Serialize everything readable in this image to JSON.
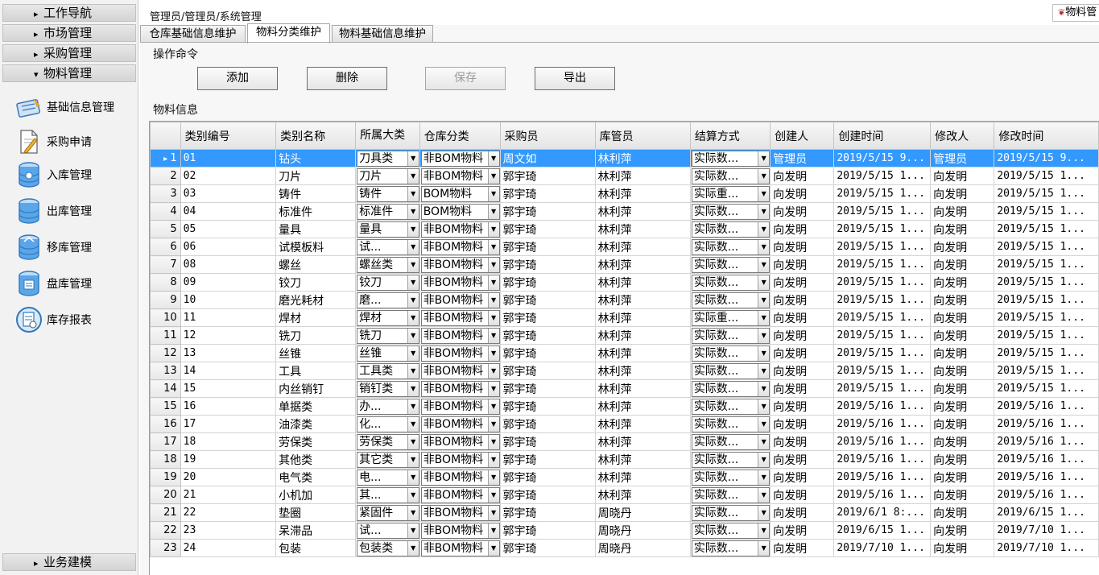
{
  "breadcrumb": "管理员/管理员/系统管理",
  "top_tab": "物料管",
  "sidebar": {
    "headers": [
      {
        "label": "工作导航",
        "arrow": "▸"
      },
      {
        "label": "市场管理",
        "arrow": "▸"
      },
      {
        "label": "采购管理",
        "arrow": "▸"
      },
      {
        "label": "物料管理",
        "arrow": "▾"
      }
    ],
    "items": [
      {
        "label": "基础信息管理",
        "icon": "basic-info-icon"
      },
      {
        "label": "采购申请",
        "icon": "purchase-request-icon"
      },
      {
        "label": "入库管理",
        "icon": "inbound-database-icon"
      },
      {
        "label": "出库管理",
        "icon": "outbound-database-icon"
      },
      {
        "label": "移库管理",
        "icon": "transfer-database-icon"
      },
      {
        "label": "盘库管理",
        "icon": "inventory-check-icon"
      },
      {
        "label": "库存报表",
        "icon": "stock-report-icon"
      }
    ],
    "footer": {
      "label": "业务建模",
      "arrow": "▸"
    }
  },
  "tabs": [
    {
      "label": "仓库基础信息维护",
      "active": false
    },
    {
      "label": "物料分类维护",
      "active": true
    },
    {
      "label": "物料基础信息维护",
      "active": false
    }
  ],
  "ops": {
    "title": "操作命令",
    "add": "添加",
    "delete": "删除",
    "save": "保存",
    "export": "导出"
  },
  "info_title": "物料信息",
  "grid": {
    "columns": [
      "类别编号",
      "类别名称",
      "所属大类",
      "仓库分类",
      "采购员",
      "库管员",
      "结算方式",
      "创建人",
      "创建时间",
      "修改人",
      "修改时间"
    ],
    "rows": [
      [
        "1",
        "01",
        "钻头",
        "刀具类",
        "非BOM物料",
        "周文如",
        "林利萍",
        "实际数...",
        "管理员",
        "2019/5/15 9...",
        "管理员",
        "2019/5/15 9..."
      ],
      [
        "2",
        "02",
        "刀片",
        "刀片",
        "非BOM物料",
        "郭宇琦",
        "林利萍",
        "实际数...",
        "向发明",
        "2019/5/15 1...",
        "向发明",
        "2019/5/15 1..."
      ],
      [
        "3",
        "03",
        "铸件",
        "铸件",
        "BOM物料",
        "郭宇琦",
        "林利萍",
        "实际重...",
        "向发明",
        "2019/5/15 1...",
        "向发明",
        "2019/5/15 1..."
      ],
      [
        "4",
        "04",
        "标准件",
        "标准件",
        "BOM物料",
        "郭宇琦",
        "林利萍",
        "实际数...",
        "向发明",
        "2019/5/15 1...",
        "向发明",
        "2019/5/15 1..."
      ],
      [
        "5",
        "05",
        "量具",
        "量具",
        "非BOM物料",
        "郭宇琦",
        "林利萍",
        "实际数...",
        "向发明",
        "2019/5/15 1...",
        "向发明",
        "2019/5/15 1..."
      ],
      [
        "6",
        "06",
        "试模板料",
        "试...",
        "非BOM物料",
        "郭宇琦",
        "林利萍",
        "实际数...",
        "向发明",
        "2019/5/15 1...",
        "向发明",
        "2019/5/15 1..."
      ],
      [
        "7",
        "08",
        "螺丝",
        "螺丝类",
        "非BOM物料",
        "郭宇琦",
        "林利萍",
        "实际数...",
        "向发明",
        "2019/5/15 1...",
        "向发明",
        "2019/5/15 1..."
      ],
      [
        "8",
        "09",
        "铰刀",
        "铰刀",
        "非BOM物料",
        "郭宇琦",
        "林利萍",
        "实际数...",
        "向发明",
        "2019/5/15 1...",
        "向发明",
        "2019/5/15 1..."
      ],
      [
        "9",
        "10",
        "磨光耗材",
        "磨...",
        "非BOM物料",
        "郭宇琦",
        "林利萍",
        "实际数...",
        "向发明",
        "2019/5/15 1...",
        "向发明",
        "2019/5/15 1..."
      ],
      [
        "10",
        "11",
        "焊材",
        "焊材",
        "非BOM物料",
        "郭宇琦",
        "林利萍",
        "实际重...",
        "向发明",
        "2019/5/15 1...",
        "向发明",
        "2019/5/15 1..."
      ],
      [
        "11",
        "12",
        "铣刀",
        "铣刀",
        "非BOM物料",
        "郭宇琦",
        "林利萍",
        "实际数...",
        "向发明",
        "2019/5/15 1...",
        "向发明",
        "2019/5/15 1..."
      ],
      [
        "12",
        "13",
        "丝锥",
        "丝锥",
        "非BOM物料",
        "郭宇琦",
        "林利萍",
        "实际数...",
        "向发明",
        "2019/5/15 1...",
        "向发明",
        "2019/5/15 1..."
      ],
      [
        "13",
        "14",
        "工具",
        "工具类",
        "非BOM物料",
        "郭宇琦",
        "林利萍",
        "实际数...",
        "向发明",
        "2019/5/15 1...",
        "向发明",
        "2019/5/15 1..."
      ],
      [
        "14",
        "15",
        "内丝销钉",
        "销钉类",
        "非BOM物料",
        "郭宇琦",
        "林利萍",
        "实际数...",
        "向发明",
        "2019/5/15 1...",
        "向发明",
        "2019/5/15 1..."
      ],
      [
        "15",
        "16",
        "单据类",
        "办...",
        "非BOM物料",
        "郭宇琦",
        "林利萍",
        "实际数...",
        "向发明",
        "2019/5/16 1...",
        "向发明",
        "2019/5/16 1..."
      ],
      [
        "16",
        "17",
        "油漆类",
        "化...",
        "非BOM物料",
        "郭宇琦",
        "林利萍",
        "实际数...",
        "向发明",
        "2019/5/16 1...",
        "向发明",
        "2019/5/16 1..."
      ],
      [
        "17",
        "18",
        "劳保类",
        "劳保类",
        "非BOM物料",
        "郭宇琦",
        "林利萍",
        "实际数...",
        "向发明",
        "2019/5/16 1...",
        "向发明",
        "2019/5/16 1..."
      ],
      [
        "18",
        "19",
        "其他类",
        "其它类",
        "非BOM物料",
        "郭宇琦",
        "林利萍",
        "实际数...",
        "向发明",
        "2019/5/16 1...",
        "向发明",
        "2019/5/16 1..."
      ],
      [
        "19",
        "20",
        "电气类",
        "电...",
        "非BOM物料",
        "郭宇琦",
        "林利萍",
        "实际数...",
        "向发明",
        "2019/5/16 1...",
        "向发明",
        "2019/5/16 1..."
      ],
      [
        "20",
        "21",
        "小机加",
        "其...",
        "非BOM物料",
        "郭宇琦",
        "林利萍",
        "实际数...",
        "向发明",
        "2019/5/16 1...",
        "向发明",
        "2019/5/16 1..."
      ],
      [
        "21",
        "22",
        "垫圈",
        "紧固件",
        "非BOM物料",
        "郭宇琦",
        "周晓丹",
        "实际数...",
        "向发明",
        "2019/6/1 8:...",
        "向发明",
        "2019/6/15 1..."
      ],
      [
        "22",
        "23",
        "呆滞品",
        "试...",
        "非BOM物料",
        "郭宇琦",
        "周晓丹",
        "实际数...",
        "向发明",
        "2019/6/15 1...",
        "向发明",
        "2019/7/10 1..."
      ],
      [
        "23",
        "24",
        "包装",
        "包装类",
        "非BOM物料",
        "郭宇琦",
        "周晓丹",
        "实际数...",
        "向发明",
        "2019/7/10 1...",
        "向发明",
        "2019/7/10 1..."
      ]
    ]
  },
  "colors": {
    "selection": "#3399ff",
    "header_bg": "#e4e4e4"
  }
}
